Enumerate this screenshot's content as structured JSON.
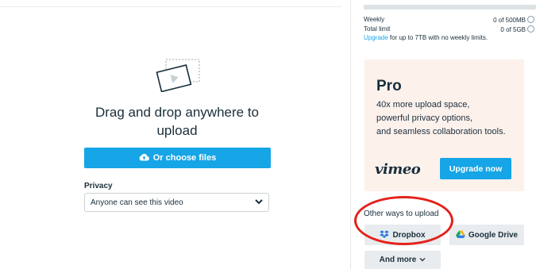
{
  "upload": {
    "headline": "Drag and drop anywhere to upload",
    "choose_files_label": "Or choose files",
    "privacy_label": "Privacy",
    "privacy_value": "Anyone can see this video"
  },
  "usage": {
    "weekly_label": "Weekly",
    "weekly_value": "0 of 500MB",
    "weekly_fraction": 0,
    "total_label": "Total limit",
    "total_value": "0 of 5GB",
    "upgrade_link": "Upgrade",
    "upgrade_text": " for up to 7TB with no weekly limits."
  },
  "pro": {
    "title": "Pro",
    "desc_line1": "40x more upload space,",
    "desc_line2": "powerful privacy options,",
    "desc_line3": "and seamless collaboration tools.",
    "logo": "vimeo",
    "upgrade_button": "Upgrade now"
  },
  "other_ways": {
    "label": "Other ways to upload",
    "dropbox": "Dropbox",
    "google_drive": "Google Drive",
    "more": "And more"
  },
  "colors": {
    "accent": "#16a5e6",
    "pro_bg": "#fdf1ec",
    "annotation": "#e4211b"
  },
  "icons": {
    "upload_illustration": "video-frame-illustration",
    "choose_files": "cloud-upload-icon",
    "select_arrow": "chevron-down-icon",
    "info": "info-icon",
    "dropbox": "dropbox-icon",
    "google_drive": "google-drive-icon",
    "more": "chevron-down-icon"
  }
}
